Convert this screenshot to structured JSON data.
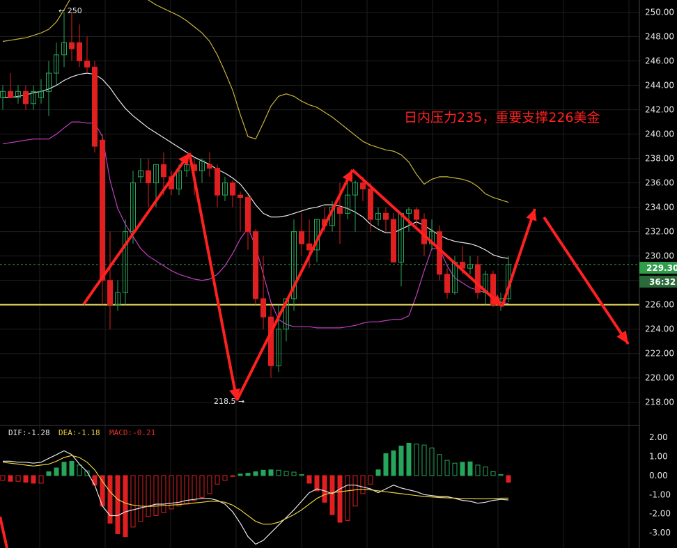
{
  "chart_data": [
    {
      "type": "candlestick",
      "price_axis": {
        "ticks": [
          "250.00",
          "248.00",
          "246.00",
          "244.00",
          "242.00",
          "240.00",
          "238.00",
          "236.00",
          "234.00",
          "232.00",
          "230.00",
          "228.00",
          "226.00",
          "224.00",
          "222.00",
          "220.00",
          "218.00"
        ],
        "ylim": [
          216.5,
          251
        ]
      },
      "current_price_label": "229.30",
      "countdown_label": "36:32",
      "support_level": 226.0,
      "max_marker": "← 250",
      "min_marker": "218.5 →",
      "annotation": "日内压力235，重要支撑226美金",
      "colors": {
        "up": "#26a65b",
        "down": "#e02020",
        "bb_upper": "#c8b43c",
        "bb_mid": "#e8e8e8",
        "bb_lower": "#c040c0",
        "support": "#f0e060",
        "arrow": "#ff2020",
        "price_tag": "#2e9e4a"
      },
      "candles": [
        [
          243,
          244,
          242,
          243.5
        ],
        [
          243.5,
          245,
          243,
          243
        ],
        [
          243,
          244,
          242.5,
          243.5
        ],
        [
          243.5,
          244,
          242,
          242.5
        ],
        [
          242.5,
          244,
          242,
          243.5
        ],
        [
          243,
          244.5,
          242.5,
          243.5
        ],
        [
          243.5,
          246,
          241.5,
          245
        ],
        [
          245,
          247.5,
          244,
          246.5
        ],
        [
          246.5,
          250,
          245.5,
          247.5
        ],
        [
          247.5,
          250,
          246,
          247
        ],
        [
          247.5,
          249,
          245.5,
          246
        ],
        [
          246,
          248,
          245,
          245.5
        ],
        [
          245.5,
          246,
          238.5,
          239
        ],
        [
          239.5,
          240,
          226,
          228
        ],
        [
          228,
          232,
          224,
          226
        ],
        [
          226,
          228,
          225.5,
          227
        ],
        [
          227,
          233,
          226,
          232
        ],
        [
          232,
          237,
          231,
          236
        ],
        [
          236.5,
          238,
          236,
          237
        ],
        [
          237,
          238,
          234,
          236
        ],
        [
          236,
          237.5,
          234,
          237.5
        ],
        [
          237.5,
          238.5,
          235,
          236.5
        ],
        [
          236.5,
          237,
          235,
          235.5
        ],
        [
          235.5,
          237.5,
          235,
          237
        ],
        [
          237,
          238,
          236.5,
          237.5
        ],
        [
          237.5,
          238,
          235,
          237
        ],
        [
          237,
          238,
          236,
          237.8
        ],
        [
          237.5,
          238.5,
          236.5,
          237.2
        ],
        [
          237.2,
          237.5,
          234,
          235
        ],
        [
          235,
          236.5,
          234.5,
          236
        ],
        [
          236,
          236.2,
          234,
          235
        ],
        [
          235,
          235.3,
          232,
          234.8
        ],
        [
          234.8,
          235,
          230.5,
          232
        ],
        [
          232,
          232.2,
          226,
          226.5
        ],
        [
          226.5,
          230,
          224,
          225
        ],
        [
          225,
          226,
          220,
          221
        ],
        [
          221,
          226,
          220.5,
          224
        ],
        [
          224,
          226.5,
          223,
          226.5
        ],
        [
          226.5,
          233,
          225.5,
          232
        ],
        [
          232,
          233.5,
          230,
          231
        ],
        [
          231,
          233,
          229,
          230.5
        ],
        [
          230.5,
          233,
          229.5,
          233
        ],
        [
          233,
          234,
          232,
          232.5
        ],
        [
          232.5,
          234.5,
          232,
          234
        ],
        [
          234,
          236,
          231,
          233.5
        ],
        [
          233.5,
          236,
          233,
          235
        ],
        [
          235,
          236.2,
          232,
          236
        ],
        [
          236,
          236.5,
          234.5,
          235.5
        ],
        [
          235.5,
          236,
          232,
          233
        ],
        [
          233,
          234,
          232.5,
          233.5
        ],
        [
          233.5,
          234,
          232,
          233
        ],
        [
          233,
          233.5,
          229.5,
          229.5
        ],
        [
          229.5,
          233.5,
          227.5,
          233.5
        ],
        [
          233.5,
          234,
          232,
          233.8
        ],
        [
          233.8,
          234,
          232.5,
          233
        ],
        [
          233,
          233.5,
          230,
          231
        ],
        [
          231,
          233,
          230.5,
          232
        ],
        [
          232,
          232.5,
          228,
          228.5
        ],
        [
          228.5,
          229,
          226.5,
          227
        ],
        [
          227,
          230,
          226.8,
          229.5
        ],
        [
          229.5,
          230.8,
          228.5,
          229
        ],
        [
          229,
          230,
          228.5,
          229.3
        ],
        [
          229.3,
          230,
          226.5,
          227
        ],
        [
          227,
          228.8,
          226,
          228.5
        ],
        [
          228.5,
          228.8,
          225.8,
          226
        ],
        [
          226,
          227,
          225.5,
          226.5
        ],
        [
          226.5,
          230,
          226.2,
          229.3
        ]
      ],
      "bb_upper": [
        247.6,
        247.7,
        247.8,
        247.9,
        248.1,
        248.3,
        248.6,
        249.2,
        250.2,
        251.3,
        252.5,
        253.2,
        253.5,
        253.4,
        253.1,
        252.8,
        252.4,
        252,
        251.5,
        251,
        250.6,
        250.3,
        250,
        249.7,
        249.3,
        248.8,
        248.3,
        247.6,
        246.5,
        245.1,
        243.6,
        241.6,
        239.8,
        239.6,
        240.9,
        242.3,
        243.1,
        243.3,
        243.1,
        242.7,
        242.4,
        242.2,
        241.8,
        241.4,
        240.9,
        240.4,
        239.9,
        239.4,
        239.1,
        238.9,
        238.7,
        238.6,
        238.3,
        237.7,
        236.7,
        235.9,
        236.3,
        236.5,
        236.5,
        236.4,
        236.3,
        236.1,
        235.7,
        235.1,
        234.8,
        234.6,
        234.4
      ],
      "bb_mid": [
        243,
        243,
        243.1,
        243.2,
        243.4,
        243.5,
        243.7,
        244,
        244.4,
        244.7,
        244.9,
        245,
        244.9,
        244.5,
        243.8,
        242.9,
        242.1,
        241.5,
        241,
        240.5,
        240.1,
        239.7,
        239.3,
        238.9,
        238.5,
        238.1,
        237.8,
        237.5,
        237.1,
        236.8,
        236.4,
        235.9,
        235.1,
        234.2,
        233.5,
        233.2,
        233.2,
        233.3,
        233.5,
        233.7,
        233.9,
        234,
        234.2,
        234.2,
        234.1,
        233.9,
        233.6,
        233.2,
        232.6,
        232.2,
        231.9,
        231.9,
        232.2,
        232.5,
        232.8,
        232.5,
        232.1,
        231.7,
        231.4,
        231.2,
        231.1,
        231,
        230.8,
        230.5,
        230.1,
        229.9,
        229.8
      ],
      "bb_lower": [
        239.2,
        239.3,
        239.4,
        239.5,
        239.6,
        239.6,
        239.6,
        240,
        240.5,
        241,
        241,
        240.9,
        240.9,
        239.8,
        236.2,
        233.9,
        232.6,
        231.6,
        230.6,
        230,
        229.6,
        229.2,
        228.8,
        228.5,
        228.3,
        228.1,
        228,
        228.1,
        228.5,
        229.2,
        230.2,
        231.4,
        232.3,
        230.8,
        228.5,
        226.2,
        224.8,
        224.4,
        224.2,
        224.2,
        224.2,
        224.1,
        224.1,
        224.1,
        224.1,
        224.2,
        224.3,
        224.5,
        224.6,
        224.6,
        224.7,
        224.8,
        224.8,
        225.1,
        226.8,
        228.8,
        230.6,
        230.6,
        229.2,
        228.2,
        227.8,
        227.4,
        227.2,
        227,
        226.8,
        226.2,
        226.1
      ]
    },
    {
      "type": "macd",
      "dif_label": "DIF:-1.28",
      "dea_label": "DEA:-1.18",
      "macd_label": "MACD:-0.21",
      "dif_color": "#e8e8e8",
      "dea_color": "#e8d040",
      "macd_label_color": "#e03030",
      "axis_ticks": [
        "2.00",
        "1.00",
        "0.00",
        "-1.00",
        "-2.00",
        "-3.00"
      ],
      "ylim": [
        -3.8,
        2.3
      ],
      "histogram": [
        -0.25,
        -0.3,
        -0.3,
        -0.35,
        -0.4,
        -0.4,
        0.2,
        0.4,
        0.7,
        0.75,
        0.55,
        0.25,
        -0.5,
        -1.6,
        -2.5,
        -3.05,
        -3.2,
        -2.7,
        -2.4,
        -2.15,
        -2.1,
        -1.95,
        -1.75,
        -1.6,
        -1.5,
        -1.3,
        -1.15,
        -0.95,
        -0.45,
        -0.25,
        -0.05,
        0.08,
        0.12,
        0.2,
        0.28,
        0.3,
        0.28,
        0.22,
        0.18,
        0.05,
        -0.4,
        -0.8,
        -1.4,
        -2.05,
        -2.45,
        -2.35,
        -1.6,
        -0.95,
        -0.45,
        0.3,
        1.15,
        1.3,
        1.55,
        1.7,
        1.65,
        1.6,
        1.45,
        1.1,
        0.8,
        0.65,
        0.7,
        0.72,
        0.55,
        0.45,
        0.2,
        0.05,
        -0.35
      ],
      "hist_colors": "up-green / down-red",
      "dif": [
        0.75,
        0.75,
        0.7,
        0.7,
        0.65,
        0.7,
        0.9,
        1.1,
        1.3,
        1.1,
        0.6,
        0.2,
        -0.5,
        -1.6,
        -2.1,
        -2.1,
        -1.9,
        -1.8,
        -1.7,
        -1.6,
        -1.5,
        -1.5,
        -1.45,
        -1.4,
        -1.3,
        -1.25,
        -1.2,
        -1.2,
        -1.3,
        -1.5,
        -1.9,
        -2.5,
        -3.2,
        -3.6,
        -3.4,
        -3,
        -2.6,
        -2.2,
        -1.8,
        -1.35,
        -0.9,
        -0.7,
        -0.8,
        -0.95,
        -0.7,
        -0.5,
        -0.5,
        -0.6,
        -0.7,
        -0.9,
        -0.7,
        -0.5,
        -0.65,
        -0.75,
        -0.85,
        -1,
        -1.05,
        -1.1,
        -1.1,
        -1.2,
        -1.3,
        -1.35,
        -1.45,
        -1.4,
        -1.3,
        -1.25,
        -1.28
      ],
      "dea": [
        0.7,
        0.65,
        0.6,
        0.55,
        0.5,
        0.55,
        0.6,
        0.75,
        0.95,
        1.05,
        0.95,
        0.7,
        0.3,
        -0.3,
        -0.85,
        -1.25,
        -1.45,
        -1.55,
        -1.6,
        -1.62,
        -1.6,
        -1.58,
        -1.55,
        -1.52,
        -1.48,
        -1.44,
        -1.4,
        -1.35,
        -1.35,
        -1.4,
        -1.55,
        -1.8,
        -2.1,
        -2.4,
        -2.55,
        -2.55,
        -2.45,
        -2.25,
        -2.05,
        -1.8,
        -1.5,
        -1.2,
        -1.0,
        -0.9,
        -0.85,
        -0.8,
        -0.75,
        -0.72,
        -0.75,
        -0.8,
        -0.85,
        -0.9,
        -0.95,
        -1.0,
        -1.05,
        -1.1,
        -1.12,
        -1.15,
        -1.17,
        -1.18,
        -1.2,
        -1.2,
        -1.22,
        -1.22,
        -1.2,
        -1.19,
        -1.18
      ]
    }
  ]
}
